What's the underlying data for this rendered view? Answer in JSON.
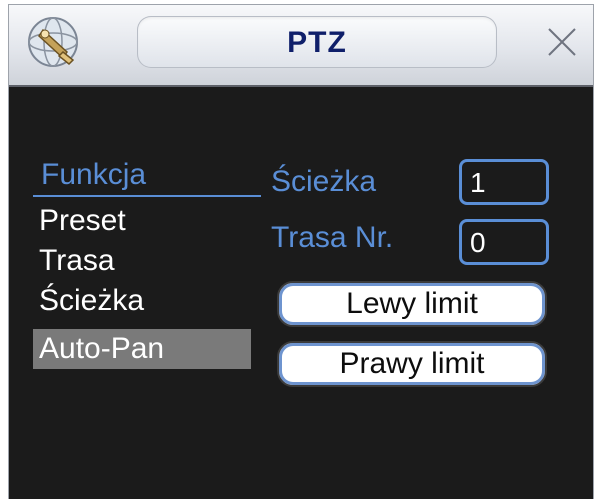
{
  "window": {
    "title": "PTZ"
  },
  "menu": {
    "header": "Funkcja",
    "items": [
      {
        "label": "Preset"
      },
      {
        "label": "Trasa"
      },
      {
        "label": "Ścieżka"
      },
      {
        "label": "Auto-Pan"
      }
    ],
    "selected_index": 3
  },
  "fields": {
    "path_label": "Ścieżka",
    "path_value": "1",
    "route_label": "Trasa Nr.",
    "route_value": "0"
  },
  "buttons": {
    "left_limit": "Lewy limit",
    "right_limit": "Prawy limit"
  },
  "icons": {
    "logo": "globe-camera-logo-icon",
    "close": "close-icon"
  },
  "colors": {
    "accent": "#5a8ed6",
    "title_text": "#0f1f6a",
    "background": "#1b1b1b",
    "selected": "#7a7a7a"
  }
}
